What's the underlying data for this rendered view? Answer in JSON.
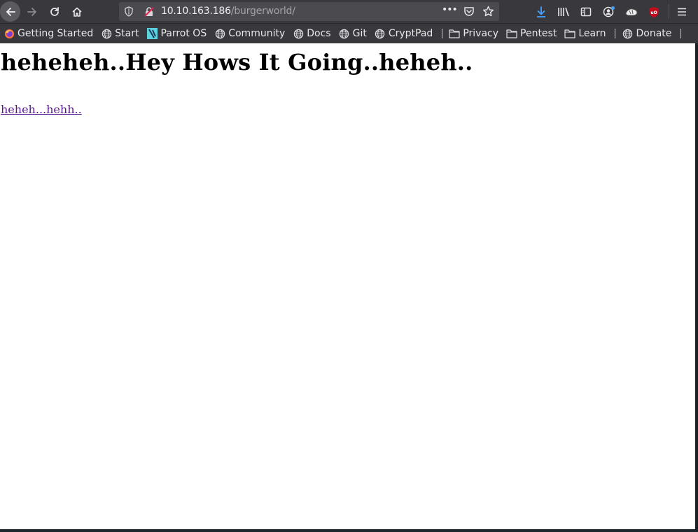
{
  "toolbar": {
    "back_icon": "arrow-left-icon",
    "forward_icon": "arrow-right-icon",
    "reload_icon": "reload-icon",
    "home_icon": "home-icon",
    "url": {
      "host": "10.10.163.186",
      "path": "/burgerworld/"
    },
    "right_icons": [
      "download-icon",
      "library-icon",
      "sidebar-icon",
      "account-icon",
      "extension-icon",
      "ublock-icon",
      "menu-icon"
    ]
  },
  "bookmarks": [
    {
      "label": "Getting Started",
      "icon": "firefox-icon"
    },
    {
      "label": "Start",
      "icon": "globe-icon"
    },
    {
      "label": "Parrot OS",
      "icon": "parrot-icon"
    },
    {
      "label": "Community",
      "icon": "globe-icon"
    },
    {
      "label": "Docs",
      "icon": "globe-icon"
    },
    {
      "label": "Git",
      "icon": "globe-icon"
    },
    {
      "label": "CryptPad",
      "icon": "globe-icon"
    },
    {
      "label": "Privacy",
      "icon": "folder-icon"
    },
    {
      "label": "Pentest",
      "icon": "folder-icon"
    },
    {
      "label": "Learn",
      "icon": "folder-icon"
    },
    {
      "label": "Donate",
      "icon": "globe-icon"
    }
  ],
  "page": {
    "heading": "heheheh..Hey Hows It Going..heheh..",
    "link": "heheh...hehh.."
  },
  "colors": {
    "toolbar_bg": "#38383d",
    "link_visited": "#551a8b",
    "download_accent": "#45a1ff",
    "ublock_red": "#c40c1c"
  }
}
